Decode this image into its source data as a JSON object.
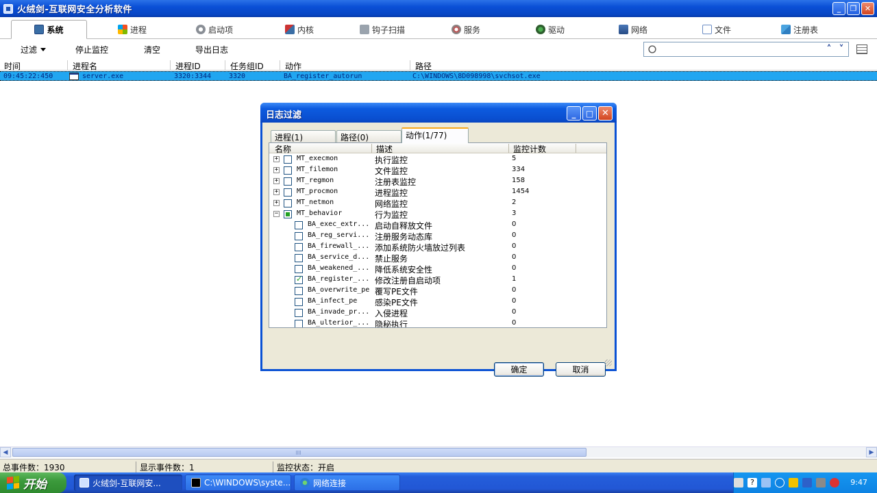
{
  "window": {
    "title": "火绒剑-互联网安全分析软件"
  },
  "main_tabs": [
    {
      "label": "系统",
      "icon": "monitor-icon",
      "active": true
    },
    {
      "label": "进程",
      "icon": "windows-flag-icon"
    },
    {
      "label": "启动项",
      "icon": "gear-icon"
    },
    {
      "label": "内核",
      "icon": "wrench-icon"
    },
    {
      "label": "钩子扫描",
      "icon": "hook-icon"
    },
    {
      "label": "服务",
      "icon": "service-icon"
    },
    {
      "label": "驱动",
      "icon": "driver-icon"
    },
    {
      "label": "网络",
      "icon": "network-icon"
    },
    {
      "label": "文件",
      "icon": "file-icon"
    },
    {
      "label": "注册表",
      "icon": "registry-icon"
    }
  ],
  "toolbar": {
    "filter": "过滤",
    "stop": "停止监控",
    "clear": "清空",
    "export": "导出日志",
    "search_value": ""
  },
  "log_table": {
    "columns": [
      "时间",
      "进程名",
      "进程ID",
      "任务组ID",
      "动作",
      "路径"
    ],
    "rows": [
      {
        "time": "09:45:22:450",
        "process": "server.exe",
        "pid": "3320:3344",
        "group": "3320",
        "action": "BA_register_autorun",
        "path": "C:\\WINDOWS\\8D098998\\svchsot.exe"
      }
    ]
  },
  "status": {
    "total": "总事件数：1930",
    "shown": "显示事件数：1",
    "monitor": "监控状态：开启"
  },
  "dialog": {
    "title": "日志过滤",
    "tabs": [
      "进程(1)",
      "路径(0)",
      "动作(1/77)"
    ],
    "columns": [
      "名称",
      "描述",
      "监控计数"
    ],
    "rows": [
      {
        "name": "MT_execmon",
        "desc": "执行监控",
        "count": "5",
        "level": 0,
        "expander": "+",
        "check": "none"
      },
      {
        "name": "MT_filemon",
        "desc": "文件监控",
        "count": "334",
        "level": 0,
        "expander": "+",
        "check": "none"
      },
      {
        "name": "MT_regmon",
        "desc": "注册表监控",
        "count": "158",
        "level": 0,
        "expander": "+",
        "check": "none"
      },
      {
        "name": "MT_procmon",
        "desc": "进程监控",
        "count": "1454",
        "level": 0,
        "expander": "+",
        "check": "none"
      },
      {
        "name": "MT_netmon",
        "desc": "网络监控",
        "count": "2",
        "level": 0,
        "expander": "+",
        "check": "none"
      },
      {
        "name": "MT_behavior",
        "desc": "行为监控",
        "count": "3",
        "level": 0,
        "expander": "−",
        "check": "partial"
      },
      {
        "name": "BA_exec_extr...",
        "desc": "启动自释放文件",
        "count": "0",
        "level": 1,
        "check": "none"
      },
      {
        "name": "BA_reg_servi...",
        "desc": "注册服务动态库",
        "count": "0",
        "level": 1,
        "check": "none"
      },
      {
        "name": "BA_firewall_...",
        "desc": "添加系统防火墙放过列表",
        "count": "0",
        "level": 1,
        "check": "none"
      },
      {
        "name": "BA_service_d...",
        "desc": "禁止服务",
        "count": "0",
        "level": 1,
        "check": "none"
      },
      {
        "name": "BA_weakened_...",
        "desc": "降低系统安全性",
        "count": "0",
        "level": 1,
        "check": "none"
      },
      {
        "name": "BA_register_...",
        "desc": "修改注册自启动项",
        "count": "1",
        "level": 1,
        "check": "checked"
      },
      {
        "name": "BA_overwrite_pe",
        "desc": "覆写PE文件",
        "count": "0",
        "level": 1,
        "check": "none"
      },
      {
        "name": "BA_infect_pe",
        "desc": "感染PE文件",
        "count": "0",
        "level": 1,
        "check": "none"
      },
      {
        "name": "BA_invade_pr...",
        "desc": "入侵进程",
        "count": "0",
        "level": 1,
        "check": "none"
      },
      {
        "name": "BA_ulterior_...",
        "desc": "隐秘执行",
        "count": "0",
        "level": 1,
        "check": "none"
      }
    ],
    "ok": "确定",
    "cancel": "取消"
  },
  "taskbar": {
    "start": "开始",
    "items": [
      {
        "label": "火绒剑-互联网安...",
        "active": true
      },
      {
        "label": "C:\\WINDOWS\\syste...",
        "active": false
      },
      {
        "label": "网络连接",
        "active": false
      }
    ],
    "clock": "9:47"
  }
}
